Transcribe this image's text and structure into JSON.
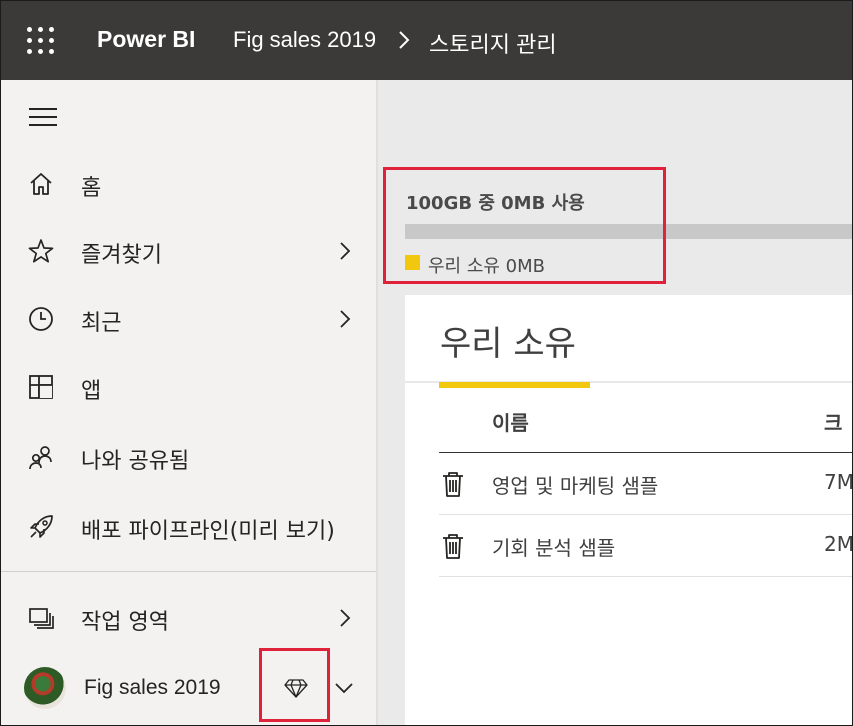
{
  "topbar": {
    "brand": "Power BI",
    "breadcrumb_workspace": "Fig sales 2019",
    "breadcrumb_page": "스토리지 관리"
  },
  "sidebar": {
    "items": [
      {
        "label": "홈",
        "icon": "home-icon"
      },
      {
        "label": "즐겨찾기",
        "icon": "star-icon"
      },
      {
        "label": "최근",
        "icon": "clock-icon"
      },
      {
        "label": "앱",
        "icon": "apps-icon"
      },
      {
        "label": "나와 공유됨",
        "icon": "shared-people-icon"
      },
      {
        "label": "배포 파이프라인(미리 보기)",
        "icon": "rocket-icon"
      },
      {
        "label": "작업 영역",
        "icon": "workspaces-icon"
      }
    ],
    "workspace": {
      "label": "Fig sales 2019",
      "premium_icon": "diamond-icon"
    }
  },
  "storage": {
    "usage_text": "100GB 중 0MB 사용",
    "legend_label": "우리 소유 0MB",
    "used_fraction": 0
  },
  "panel": {
    "tab_title": "우리 소유",
    "columns": [
      "이름",
      "크"
    ],
    "rows": [
      {
        "name": "영업 및 마케팅 샘플",
        "size": "7M"
      },
      {
        "name": "기회 분석 샘플",
        "size": "2M"
      }
    ]
  },
  "colors": {
    "topbar": "#3b3a39",
    "accent_yellow": "#f2c80f",
    "highlight_red": "#e0213a"
  }
}
